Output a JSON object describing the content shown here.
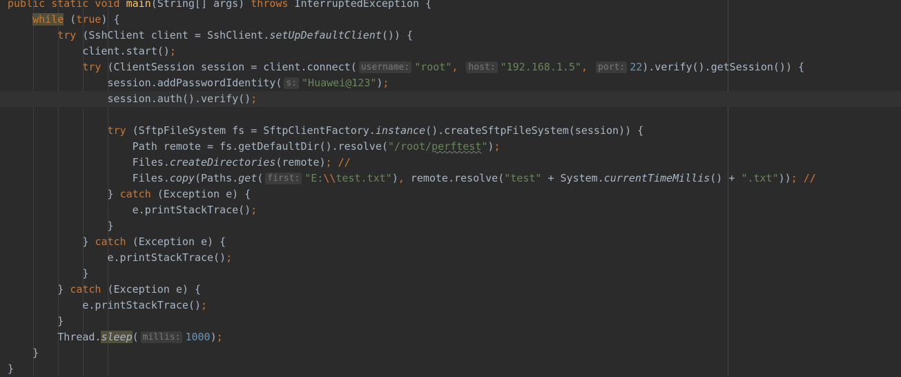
{
  "editor": {
    "language": "java",
    "theme": "darcula",
    "current_line_index": 6,
    "colors": {
      "background": "#2b2b2b",
      "current_line": "#323232",
      "keyword": "#cc7832",
      "string": "#6a8759",
      "number": "#6897bb",
      "method_declaration": "#ffc66d",
      "default_text": "#a9b7c6",
      "inlay_hint_bg": "#3b3b3b",
      "inlay_hint_text": "#787878"
    },
    "lines": [
      {
        "segments": [
          {
            "t": "public static void ",
            "c": "kw"
          },
          {
            "t": "main",
            "c": "fn"
          },
          {
            "t": "(String[] args) "
          },
          {
            "t": "throws",
            "c": "kw"
          },
          {
            "t": " InterruptedException {"
          }
        ]
      },
      {
        "segments": [
          {
            "t": "    "
          },
          {
            "t": "while",
            "c": "kw warn"
          },
          {
            "t": " ("
          },
          {
            "t": "true",
            "c": "kw"
          },
          {
            "t": ") {"
          }
        ]
      },
      {
        "segments": [
          {
            "t": "        "
          },
          {
            "t": "try",
            "c": "kw"
          },
          {
            "t": " (SshClient client = SshClient."
          },
          {
            "t": "setUpDefaultClient",
            "c": "it"
          },
          {
            "t": "()) {"
          }
        ]
      },
      {
        "segments": [
          {
            "t": "            client.start()"
          },
          {
            "t": ";",
            "c": "kw"
          }
        ]
      },
      {
        "segments": [
          {
            "t": "            "
          },
          {
            "t": "try",
            "c": "kw"
          },
          {
            "t": " (ClientSession session = client.connect("
          },
          {
            "t": "username:",
            "c": "hint"
          },
          {
            "t": "\"root\"",
            "c": "str"
          },
          {
            "t": ", ",
            "c": "kw"
          },
          {
            "t": "host:",
            "c": "hint"
          },
          {
            "t": "\"192.168.1.5\"",
            "c": "str"
          },
          {
            "t": ", ",
            "c": "kw"
          },
          {
            "t": "port:",
            "c": "hint"
          },
          {
            "t": "22",
            "c": "num"
          },
          {
            "t": ").verify().getSession()) {"
          }
        ]
      },
      {
        "segments": [
          {
            "t": "                session.addPasswordIdentity("
          },
          {
            "t": "s:",
            "c": "hint"
          },
          {
            "t": "\"Huawei@123\"",
            "c": "str"
          },
          {
            "t": ")"
          },
          {
            "t": ";",
            "c": "kw"
          }
        ]
      },
      {
        "segments": [
          {
            "t": "                session.auth().verify()"
          },
          {
            "t": ";",
            "c": "kw"
          }
        ]
      },
      {
        "segments": [
          {
            "t": ""
          }
        ]
      },
      {
        "segments": [
          {
            "t": "                "
          },
          {
            "t": "try",
            "c": "kw"
          },
          {
            "t": " (SftpFileSystem fs = SftpClientFactory."
          },
          {
            "t": "instance",
            "c": "it"
          },
          {
            "t": "().createSftpFileSystem(session)) {"
          }
        ]
      },
      {
        "segments": [
          {
            "t": "                    Path remote = fs.getDefaultDir().resolve("
          },
          {
            "t": "\"/root/",
            "c": "str"
          },
          {
            "t": "perftest",
            "c": "str squig"
          },
          {
            "t": "\"",
            "c": "str"
          },
          {
            "t": ")"
          },
          {
            "t": ";",
            "c": "kw"
          }
        ]
      },
      {
        "segments": [
          {
            "t": "                    Files."
          },
          {
            "t": "createDirectories",
            "c": "it"
          },
          {
            "t": "(remote)"
          },
          {
            "t": "; //",
            "c": "kw"
          }
        ]
      },
      {
        "segments": [
          {
            "t": "                    Files."
          },
          {
            "t": "copy",
            "c": "it"
          },
          {
            "t": "(Paths."
          },
          {
            "t": "get",
            "c": "it"
          },
          {
            "t": "("
          },
          {
            "t": "first:",
            "c": "hint"
          },
          {
            "t": "\"E:",
            "c": "str"
          },
          {
            "t": "\\\\",
            "c": "kw"
          },
          {
            "t": "test.txt\"",
            "c": "str"
          },
          {
            "t": ")"
          },
          {
            "t": ", ",
            "c": "kw"
          },
          {
            "t": "remote.resolve("
          },
          {
            "t": "\"test\"",
            "c": "str"
          },
          {
            "t": " + System."
          },
          {
            "t": "currentTimeMillis",
            "c": "it"
          },
          {
            "t": "() + "
          },
          {
            "t": "\".txt\"",
            "c": "str"
          },
          {
            "t": "))"
          },
          {
            "t": "; //",
            "c": "kw"
          }
        ]
      },
      {
        "segments": [
          {
            "t": "                } "
          },
          {
            "t": "catch",
            "c": "kw"
          },
          {
            "t": " (Exception e) {"
          }
        ]
      },
      {
        "segments": [
          {
            "t": "                    e.printStackTrace()"
          },
          {
            "t": ";",
            "c": "kw"
          }
        ]
      },
      {
        "segments": [
          {
            "t": "                }"
          }
        ]
      },
      {
        "segments": [
          {
            "t": "            } "
          },
          {
            "t": "catch",
            "c": "kw"
          },
          {
            "t": " (Exception e) {"
          }
        ]
      },
      {
        "segments": [
          {
            "t": "                e.printStackTrace()"
          },
          {
            "t": ";",
            "c": "kw"
          }
        ]
      },
      {
        "segments": [
          {
            "t": "            }"
          }
        ]
      },
      {
        "segments": [
          {
            "t": "        } "
          },
          {
            "t": "catch",
            "c": "kw"
          },
          {
            "t": " (Exception e) {"
          }
        ]
      },
      {
        "segments": [
          {
            "t": "            e.printStackTrace()"
          },
          {
            "t": ";",
            "c": "kw"
          }
        ]
      },
      {
        "segments": [
          {
            "t": "        }"
          }
        ]
      },
      {
        "segments": [
          {
            "t": "        Thread."
          },
          {
            "t": "sleep",
            "c": "it warn"
          },
          {
            "t": "("
          },
          {
            "t": "millis:",
            "c": "hint"
          },
          {
            "t": "1000",
            "c": "num"
          },
          {
            "t": ")"
          },
          {
            "t": ";",
            "c": "kw"
          }
        ]
      },
      {
        "segments": [
          {
            "t": "    }"
          }
        ]
      },
      {
        "segments": [
          {
            "t": "}"
          }
        ]
      }
    ]
  }
}
